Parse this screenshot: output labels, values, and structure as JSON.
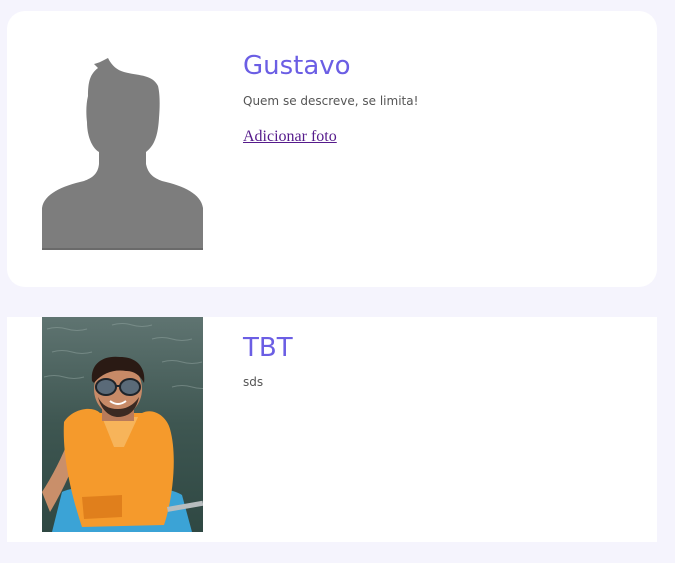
{
  "profile": {
    "name": "Gustavo",
    "bio": "Quem se descreve, se limita!",
    "add_photo_link": "Adicionar foto",
    "avatar_icon": "default-avatar-silhouette",
    "title_color": "#6b5ee4"
  },
  "posts": [
    {
      "title": "TBT",
      "description": "sds",
      "photo": "selfie-on-boat-with-life-jacket"
    }
  ]
}
